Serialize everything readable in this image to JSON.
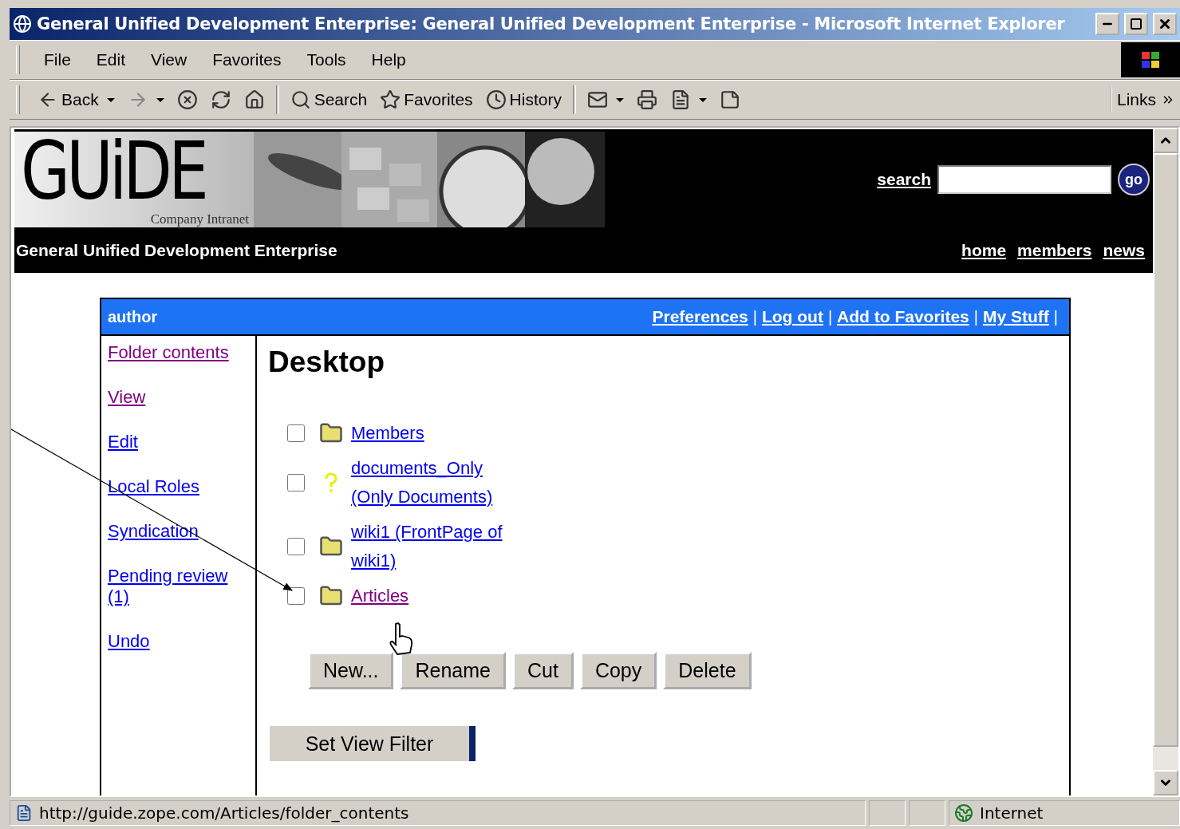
{
  "window": {
    "title": "General Unified Development Enterprise: General Unified Development Enterprise - Microsoft Internet Explorer"
  },
  "menu": [
    "File",
    "Edit",
    "View",
    "Favorites",
    "Tools",
    "Help"
  ],
  "toolbar": [
    {
      "kind": "back",
      "label": "Back"
    },
    {
      "kind": "forward"
    },
    {
      "kind": "stop"
    },
    {
      "kind": "refresh"
    },
    {
      "kind": "home"
    },
    {
      "kind": "search",
      "label": "Search"
    },
    {
      "kind": "favorites",
      "label": "Favorites"
    },
    {
      "kind": "history",
      "label": "History"
    },
    {
      "kind": "mail"
    },
    {
      "kind": "print"
    },
    {
      "kind": "edit"
    },
    {
      "kind": "discuss"
    }
  ],
  "links_label": "Links",
  "header": {
    "logo": "GUiDE",
    "logo_tagline": "Company Intranet",
    "search_label": "search",
    "go_button": "go",
    "site_name": "General Unified Development Enterprise",
    "nav": [
      "home",
      "members",
      "news"
    ]
  },
  "portal_bar": {
    "user": "author",
    "actions": [
      {
        "label": "Preferences",
        "separator": "|"
      },
      {
        "label": "Log out",
        "separator": "|"
      },
      {
        "label": "Add to Favorites",
        "separator": "|"
      },
      {
        "label": "My Stuff",
        "separator": "|"
      }
    ]
  },
  "side_nav": [
    {
      "label": "Folder contents",
      "visited": true
    },
    {
      "label": "View",
      "visited": true
    },
    {
      "label": "Edit",
      "visited": false
    },
    {
      "label": "Local Roles",
      "visited": false
    },
    {
      "label": "Syndication",
      "visited": false
    },
    {
      "label": "Pending review (1)",
      "visited": false
    },
    {
      "label": "Undo",
      "visited": false
    }
  ],
  "content": {
    "title": "Desktop",
    "items": [
      {
        "kind": "folder",
        "name": "Members",
        "checked": false,
        "visited": false
      },
      {
        "kind": "document",
        "name": "documents_Only (Only Documents)",
        "checked": false,
        "visited": false
      },
      {
        "kind": "folder",
        "name": "wiki1 (FrontPage of wiki1)",
        "checked": false,
        "visited": false
      },
      {
        "kind": "folder",
        "name": "Articles",
        "checked": false,
        "visited": true
      }
    ],
    "buttons": [
      "New...",
      "Rename",
      "Cut",
      "Copy",
      "Delete"
    ],
    "filter_button": "Set View Filter"
  },
  "status_bar": {
    "url": "http://guide.zope.com/Articles/folder_contents",
    "zone": "Internet"
  }
}
